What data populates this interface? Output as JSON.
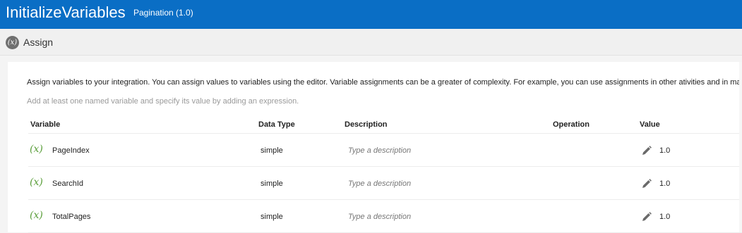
{
  "header": {
    "title": "InitializeVariables",
    "subtitle": "Pagination (1.0)"
  },
  "section": {
    "icon_text": "(x)",
    "title": "Assign"
  },
  "panel": {
    "intro": "Assign variables to your integration. You can assign values to variables using the editor. Variable assignments can be a greater of complexity. For example, you can use assignments in other ativities and in maps.",
    "hint": "Add at least one named variable and specify its value by adding an expression."
  },
  "table": {
    "columns": {
      "variable": "Variable",
      "data_type": "Data Type",
      "description": "Description",
      "operation": "Operation",
      "value": "Value"
    },
    "rows": [
      {
        "icon_text": "(x)",
        "name": "PageIndex",
        "data_type": "simple",
        "description": "",
        "description_placeholder": "Type a description",
        "operation": "",
        "value": "1.0"
      },
      {
        "icon_text": "(x)",
        "name": "SearchId",
        "data_type": "simple",
        "description": "",
        "description_placeholder": "Type a description",
        "operation": "",
        "value": "1.0"
      },
      {
        "icon_text": "(x)",
        "name": "TotalPages",
        "data_type": "simple",
        "description": "",
        "description_placeholder": "Type a description",
        "operation": "",
        "value": "1.0"
      }
    ]
  },
  "icons": {
    "variable": "variable-x-icon",
    "edit": "pencil-icon"
  },
  "colors": {
    "topbar": "#0a6ec5",
    "variable_icon": "#5a9e3a",
    "section_icon": "#6f6f6f"
  }
}
